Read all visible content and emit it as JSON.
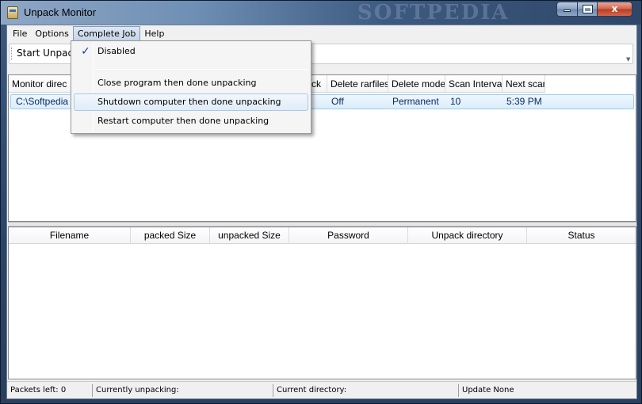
{
  "window": {
    "title": "Unpack Monitor",
    "watermark": "SOFTPEDIA",
    "controls": {
      "minimize": "",
      "maximize": "",
      "close": "x"
    }
  },
  "menubar": {
    "items": [
      "File",
      "Options",
      "Complete Job",
      "Help"
    ],
    "active": "Complete Job"
  },
  "toolbar": {
    "start_label": "Start Unpack"
  },
  "monitor_table": {
    "columns": [
      "Monitor direc",
      "",
      "ck",
      "Delete rarfiles",
      "Delete mode",
      "Scan Interval",
      "Next scan"
    ],
    "rows": [
      {
        "directory": "C:\\Softpedia",
        "delete_rarfiles": "Off",
        "delete_mode": "Permanent",
        "scan_interval": "10",
        "next_scan": "5:39 PM"
      }
    ]
  },
  "files_table": {
    "columns": [
      "Filename",
      "packed Size",
      "unpacked Size",
      "Password",
      "Unpack directory",
      "Status"
    ],
    "rows": []
  },
  "statusbar": {
    "packets_left": "Packets left:  0",
    "currently_unpacking": "Currently unpacking:",
    "current_directory": "Current directory:",
    "update": "Update   None"
  },
  "dropdown": {
    "items": [
      {
        "label": "Disabled",
        "checked": true
      },
      {
        "label": "Close program then done unpacking",
        "checked": false
      },
      {
        "label": "Shutdown computer then done unpacking",
        "checked": false,
        "highlighted": true
      },
      {
        "label": "Restart computer then done unpacking",
        "checked": false
      }
    ],
    "check_glyph": "✓"
  },
  "colors": {
    "selection_border": "#9ccdf0",
    "selection_fill": "#dbedfb",
    "row_text": "#0a2a66"
  }
}
